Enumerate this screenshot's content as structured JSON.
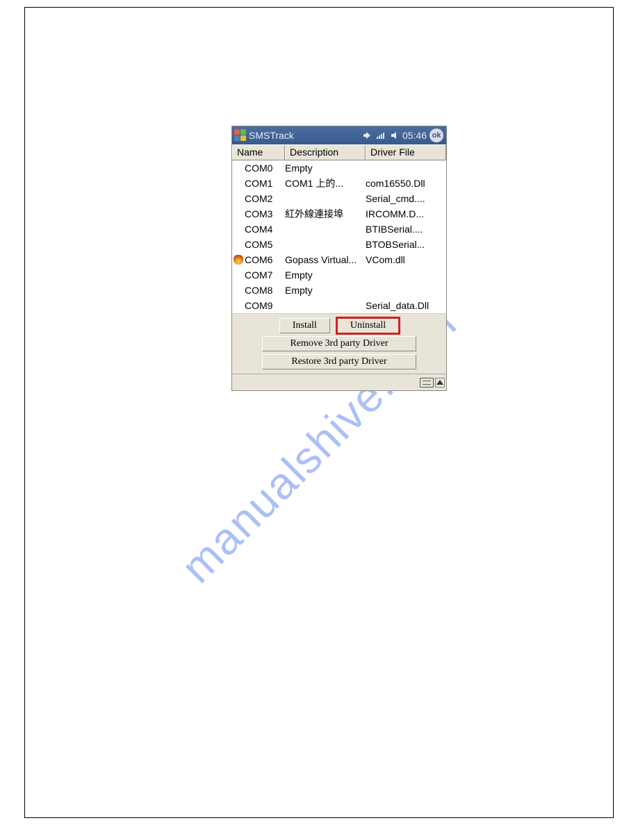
{
  "watermark": "manualshive.com",
  "titlebar": {
    "app_name": "SMSTrack",
    "clock": "05:46",
    "ok_label": "ok"
  },
  "table": {
    "headers": {
      "name": "Name",
      "description": "Description",
      "driver": "Driver File"
    },
    "rows": [
      {
        "icon": "",
        "name": "COM0",
        "description": "Empty",
        "driver": ""
      },
      {
        "icon": "",
        "name": "COM1",
        "description": "COM1 上的...",
        "driver": "com16550.Dll"
      },
      {
        "icon": "",
        "name": "COM2",
        "description": "",
        "driver": "Serial_cmd...."
      },
      {
        "icon": "",
        "name": "COM3",
        "description": "紅外線連接埠",
        "driver": "IRCOMM.D..."
      },
      {
        "icon": "",
        "name": "COM4",
        "description": "",
        "driver": "BTIBSerial...."
      },
      {
        "icon": "",
        "name": "COM5",
        "description": "",
        "driver": "BTOBSerial..."
      },
      {
        "icon": "fire",
        "name": "COM6",
        "description": "Gopass Virtual...",
        "driver": "VCom.dll"
      },
      {
        "icon": "",
        "name": "COM7",
        "description": "Empty",
        "driver": ""
      },
      {
        "icon": "",
        "name": "COM8",
        "description": "Empty",
        "driver": ""
      },
      {
        "icon": "",
        "name": "COM9",
        "description": "",
        "driver": "Serial_data.Dll"
      }
    ]
  },
  "buttons": {
    "install": "Install",
    "uninstall": "Uninstall",
    "remove": "Remove 3rd party Driver",
    "restore": "Restore 3rd party Driver"
  }
}
